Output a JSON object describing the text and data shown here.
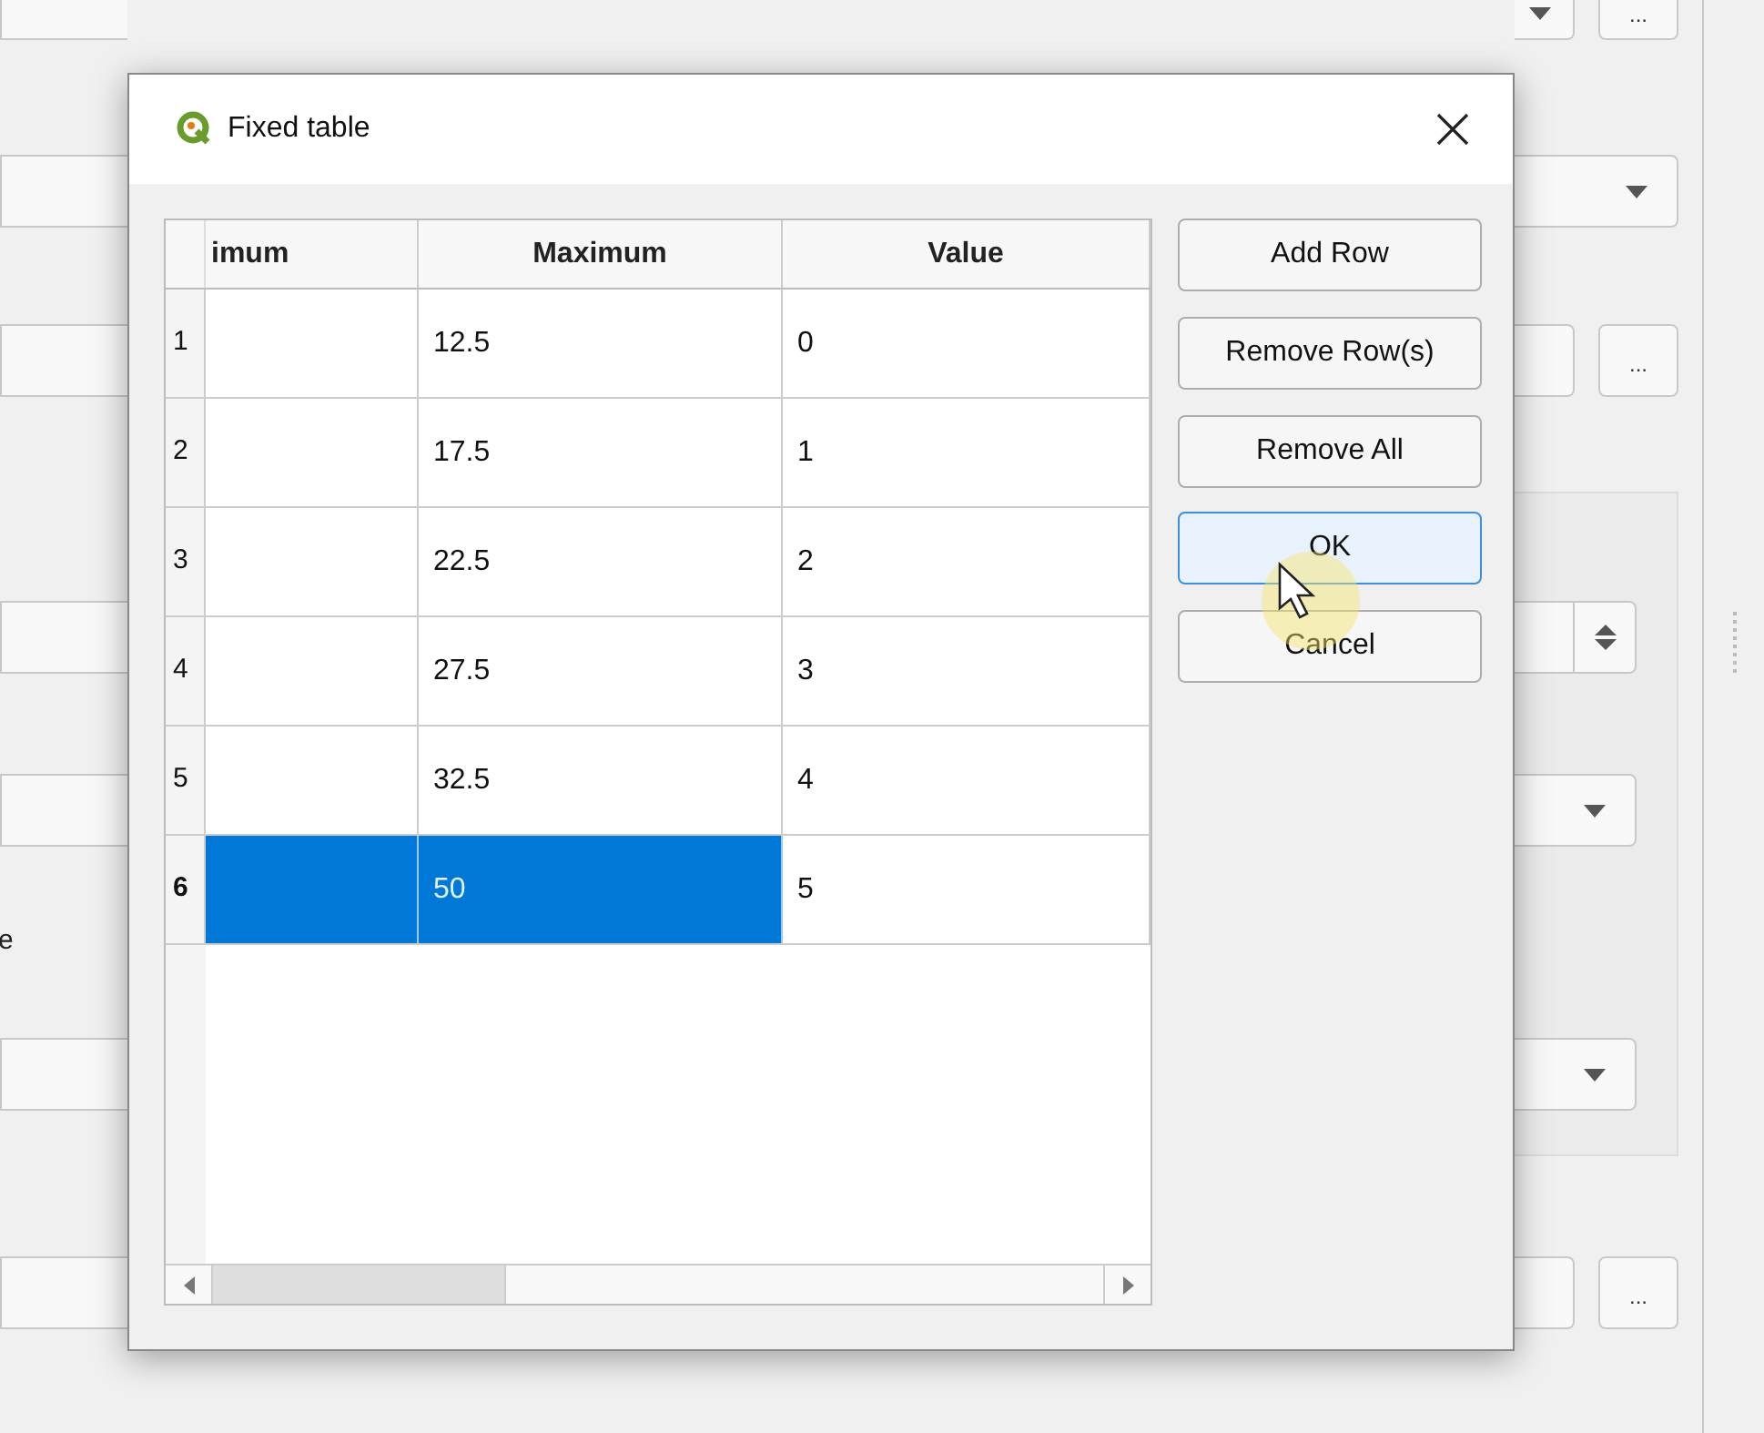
{
  "background": {
    "dots_buttons": [
      "...",
      "...",
      "..."
    ],
    "label_fragment": "e"
  },
  "dialog": {
    "title": "Fixed table",
    "table": {
      "columns": [
        "imum",
        "Maximum",
        "Value"
      ],
      "rows": [
        {
          "header": "1",
          "cells": [
            {
              "selected": false
            },
            {
              "text": "12.5",
              "selected": false
            },
            {
              "text": "0",
              "selected": false
            }
          ]
        },
        {
          "header": "2",
          "cells": [
            {
              "selected": false
            },
            {
              "text": "17.5",
              "selected": false
            },
            {
              "text": "1",
              "selected": false
            }
          ]
        },
        {
          "header": "3",
          "cells": [
            {
              "selected": false
            },
            {
              "text": "22.5",
              "selected": false
            },
            {
              "text": "2",
              "selected": false
            }
          ]
        },
        {
          "header": "4",
          "cells": [
            {
              "selected": false
            },
            {
              "text": "27.5",
              "selected": false
            },
            {
              "text": "3",
              "selected": false
            }
          ]
        },
        {
          "header": "5",
          "cells": [
            {
              "selected": false
            },
            {
              "text": "32.5",
              "selected": false
            },
            {
              "text": "4",
              "selected": false
            }
          ]
        },
        {
          "header": "6",
          "cells": [
            {
              "selected": true
            },
            {
              "text": "50",
              "selected": true
            },
            {
              "text": "5",
              "selected": false
            }
          ]
        }
      ]
    },
    "buttons": [
      {
        "label": "Add Row",
        "focused": false
      },
      {
        "label": "Remove Row(s)",
        "focused": false
      },
      {
        "label": "Remove All",
        "focused": false
      },
      {
        "label": "OK",
        "focused": true
      },
      {
        "label": "Cancel",
        "focused": false
      }
    ]
  }
}
